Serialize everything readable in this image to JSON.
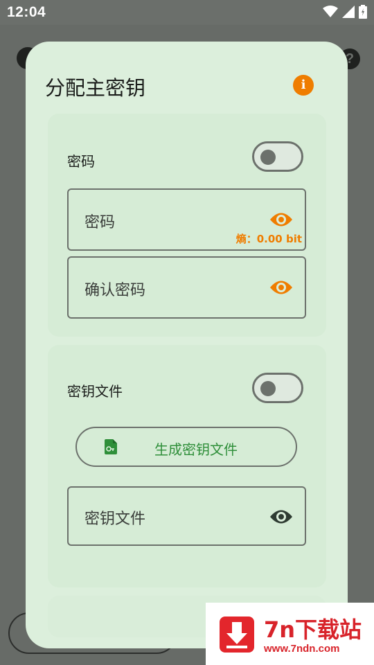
{
  "status_bar": {
    "time": "12:04",
    "icons": [
      "wifi-icon",
      "signal-icon",
      "battery-icon"
    ]
  },
  "dialog": {
    "title": "分配主密钥",
    "info_icon": "info-icon",
    "password_section": {
      "label": "密码",
      "toggle_on": false,
      "password_field": {
        "placeholder": "密码",
        "entropy": "熵：0.00 bit"
      },
      "confirm_field": {
        "placeholder": "确认密码"
      }
    },
    "keyfile_section": {
      "label": "密钥文件",
      "toggle_on": false,
      "generate_button": "生成密钥文件",
      "keyfile_field": {
        "placeholder": "密钥文件"
      }
    }
  },
  "background": {
    "help_icon": "?"
  },
  "watermark": {
    "name": "7n下载站",
    "url": "www.7ndn.com"
  },
  "colors": {
    "accent": "#ef7d00",
    "dialog_bg": "#dcefdc",
    "button_text": "#2f8f3a"
  }
}
